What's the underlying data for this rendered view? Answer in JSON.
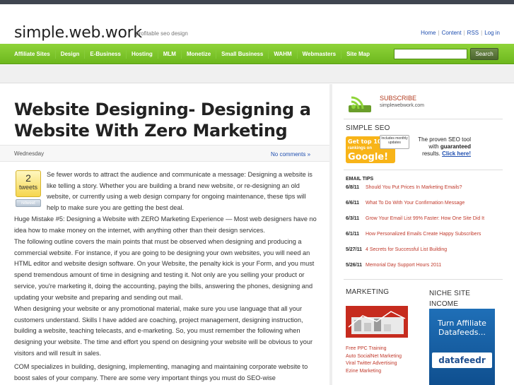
{
  "header": {
    "site_title": "simple.web.work",
    "tagline": "profitable seo design",
    "links": [
      "Home",
      "Content",
      "RSS",
      "Log in"
    ]
  },
  "nav": {
    "items": [
      "Affiliate Sites",
      "Design",
      "E-Business",
      "Hosting",
      "MLM",
      "Monetize",
      "Small Business",
      "WAHM",
      "Webmasters",
      "Site Map"
    ],
    "search_value": "",
    "search_button": "Search"
  },
  "post": {
    "title": "Website Designing- Designing a Website With Zero Marketing",
    "day": "Wednesday",
    "comments_link": "No comments »",
    "tweet_count": "2",
    "tweet_word": "tweets",
    "tweet_button": "retweet",
    "p1_first": "Se fewer words to attract the audience and communicate a message: Designing a website is like telling a story. Whether you are building a brand new website, or re-designing an old website, or currently using a web design company for ongoing maintenance, these tips will help to make sure you are getting the best deal.",
    "p1_rest": "Huge Mistake #5: Designing a Website with ZERO Marketing Experience — Most web designers have no idea how to make money on the internet, with anything other than their design services.",
    "p2": "The following outline covers the main points that must be observed when designing and producing a commercial website. For instance, if you are going to be designing your own websites, you will need an HTML editor and website design software. On your Website, the penalty kick is your Form, and you must spend tremendous amount of time in designing and testing it. Not only are you selling your product or service, you're marketing it, doing the accounting, paying the bills, answering the phones, designing and updating your website and preparing and sending out mail.",
    "p3": "When designing your website or any promotional material, make sure you use language that all your customers understand. Skills I have added are coaching, project management, designing instruction, building a website, teaching telecasts, and e-marketing. So, you must remember the following when designing your website. The time and effort you spend on designing your website will be obvious to your visitors and will result in sales.",
    "p4": "COM specializes in building, designing, implementing, managing and maintaining corporate website to boost sales of your company. There are some very important things you must do SEO-wise"
  },
  "sidebar": {
    "subscribe_title": "SUBSCRIBE",
    "subscribe_url": "simplewebwork.com",
    "seo_title": "SIMPLE SEO",
    "seo_badge_top": "Get top 10",
    "seo_badge_mid": "rankings on",
    "seo_badge_big": "Google!",
    "seo_badge_includes": "Includes monthly updates",
    "seo_copy_1": "The proven SEO tool with",
    "seo_copy_guaranteed": "guaranteed",
    "seo_copy_results": "results.",
    "seo_copy_click": "Click here!",
    "email_tips_title": "EMAIL TIPS",
    "email_tips": [
      {
        "date": "6/8/11",
        "title": "Should You Put Prices In Marketing Emails?"
      },
      {
        "date": "6/6/11",
        "title": "What To Do With Your Confirmation Message"
      },
      {
        "date": "6/3/11",
        "title": "Grow Your Email List 99% Faster: How One Site Did It"
      },
      {
        "date": "6/1/11",
        "title": "How Personalized Emails Create Happy Subscribers"
      },
      {
        "date": "5/27/11",
        "title": "4 Secrets for Successful List Building"
      },
      {
        "date": "5/26/11",
        "title": "Memorial Day Support Hours 2011"
      }
    ],
    "marketing_title": "MARKETING",
    "marketing_links": [
      "Free PPC Training",
      "Auto SocialNet Marketing",
      "Viral Twitter Advertising",
      "Ezine Marketing"
    ],
    "niche_title": "NICHE SITE INCOME",
    "niche_ad_line": "Turn Affiliate Datafeeds...",
    "niche_ad_brand": "datafeedr"
  },
  "colors": {
    "nav_green": "#7cc52a",
    "link_blue": "#1f4fb0",
    "tip_red": "#c0392b",
    "subscribe_red": "#b23a1d"
  }
}
